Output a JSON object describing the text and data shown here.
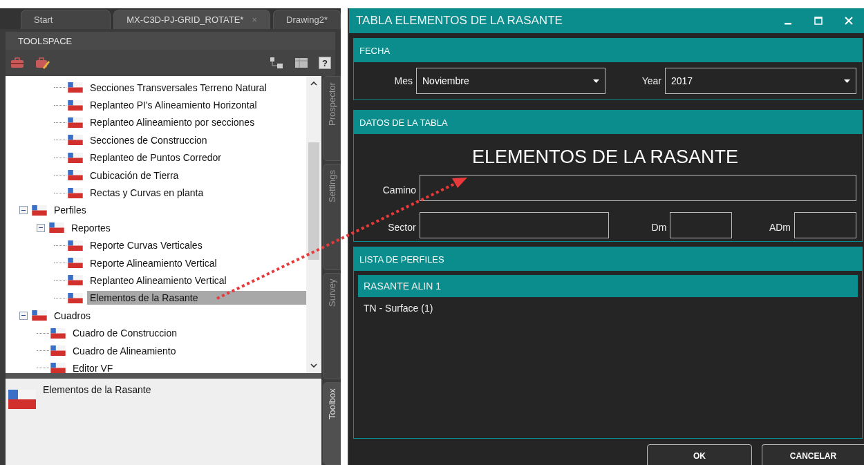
{
  "doc_tabs": [
    {
      "label": "Start",
      "selected": false
    },
    {
      "label": "MX-C3D-PJ-GRID_ROTATE*",
      "selected": true,
      "close": "×"
    },
    {
      "label": "Drawing2*",
      "selected": false
    }
  ],
  "toolspace": {
    "title": "TOOLSPACE",
    "help": "?",
    "tree": [
      {
        "children": [
          {
            "children": [
              {
                "children": [
                  {
                    "label": "Secciones Transversales Terreno Natural",
                    "selected": false
                  },
                  {
                    "label": "Replanteo PI's Alineamiento Horizontal",
                    "selected": false
                  },
                  {
                    "label": "Replanteo Alineamiento por secciones",
                    "selected": false
                  },
                  {
                    "label": "Secciones de Construccion",
                    "selected": false
                  },
                  {
                    "label": "Replanteo de Puntos Corredor",
                    "selected": false
                  },
                  {
                    "label": "Cubicación de Tierra",
                    "selected": false
                  },
                  {
                    "label": "Rectas y Curvas en planta",
                    "selected": false
                  }
                ]
              }
            ]
          },
          {
            "label": "Perfiles",
            "expanded": true,
            "selected": false,
            "children": [
              {
                "label": "Reportes",
                "expanded": true,
                "selected": false,
                "children": [
                  {
                    "label": "Reporte Curvas Verticales",
                    "selected": false
                  },
                  {
                    "label": "Reporte Alineamiento Vertical",
                    "selected": false
                  },
                  {
                    "label": "Replanteo Alineamiento Vertical",
                    "selected": false
                  },
                  {
                    "label": "Elementos de la Rasante",
                    "selected": true
                  }
                ]
              }
            ]
          },
          {
            "label": "Cuadros",
            "expanded": true,
            "selected": false,
            "children": [
              {
                "label": "Cuadro de Construccion",
                "selected": false
              },
              {
                "label": "Cuadro de Alineamiento",
                "selected": false
              },
              {
                "label": "Editor VF",
                "selected": false
              }
            ]
          }
        ]
      }
    ],
    "info": "Elementos de la Rasante",
    "side_tabs": [
      {
        "label": "Prospector",
        "selected": false
      },
      {
        "label": "Settings",
        "selected": false
      },
      {
        "label": "Survey",
        "selected": false
      },
      {
        "label": "Toolbox",
        "selected": true
      }
    ]
  },
  "dialog": {
    "title": "TABLA ELEMENTOS DE LA RASANTE",
    "fecha": {
      "header": "FECHA",
      "fields": [
        {
          "label": "Mes",
          "value": "Noviembre"
        },
        {
          "label": "Year",
          "value": "2017"
        }
      ]
    },
    "datos": {
      "header": "DATOS DE LA TABLA",
      "heading": "ELEMENTOS DE LA RASANTE",
      "camino": "Camino",
      "sector": "Sector",
      "dm": "Dm",
      "adm": "ADm"
    },
    "lista": {
      "header": "LISTA DE PERFILES",
      "items": [
        {
          "label": "RASANTE ALIN 1",
          "selected": true
        },
        {
          "label": "TN - Surface (1)",
          "selected": false
        }
      ]
    },
    "buttons": [
      "OK",
      "CANCELAR"
    ]
  }
}
